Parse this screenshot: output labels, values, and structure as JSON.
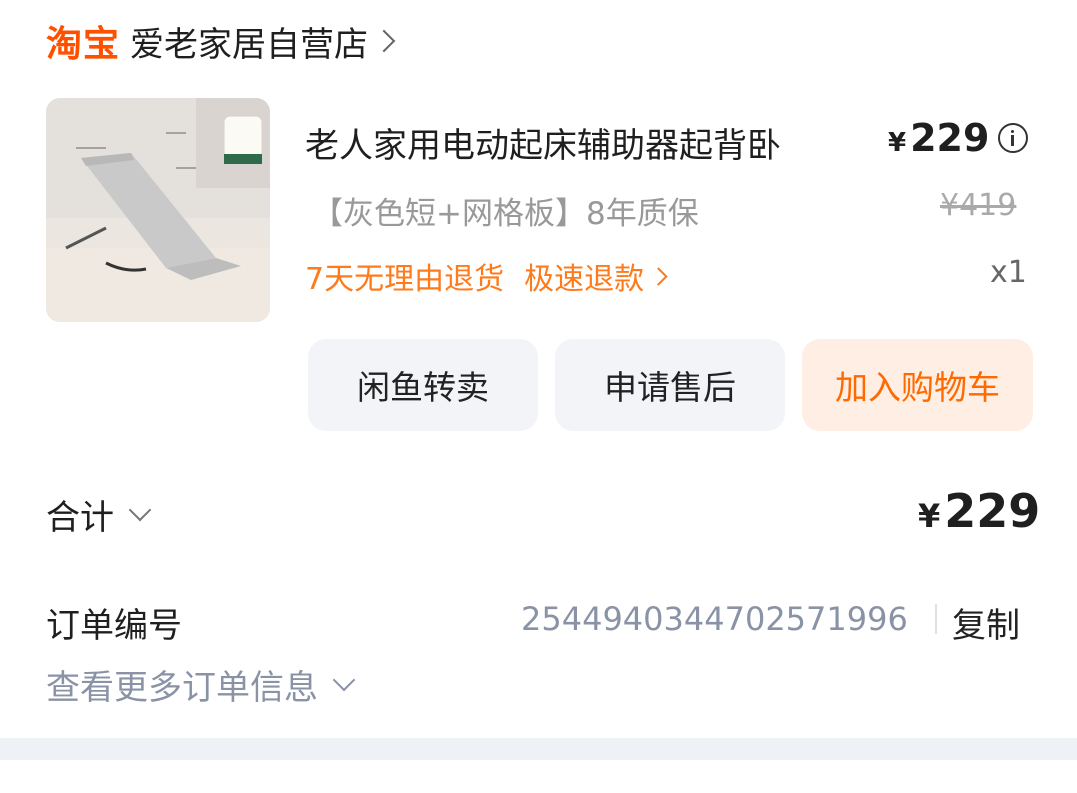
{
  "shop": {
    "logo": "淘宝",
    "name": "爱老家居自营店"
  },
  "product": {
    "title": "老人家用电动起床辅助器起背卧",
    "price_symbol": "¥",
    "price": "229",
    "spec": "【灰色短+网格板】8年质保",
    "original_price": "¥419",
    "tag1": "7天无理由退货",
    "tag2": "极速退款",
    "quantity": "x1"
  },
  "actions": {
    "resell": "闲鱼转卖",
    "after_sale": "申请售后",
    "add_to_cart": "加入购物车"
  },
  "summary": {
    "total_label": "合计",
    "total_symbol": "¥",
    "total_price": "229"
  },
  "order": {
    "label": "订单编号",
    "number": "2544940344702571996",
    "copy": "复制",
    "more": "查看更多订单信息"
  },
  "colors": {
    "brand": "#ff5000",
    "accent": "#ff6a00",
    "muted": "#8a93a6"
  }
}
